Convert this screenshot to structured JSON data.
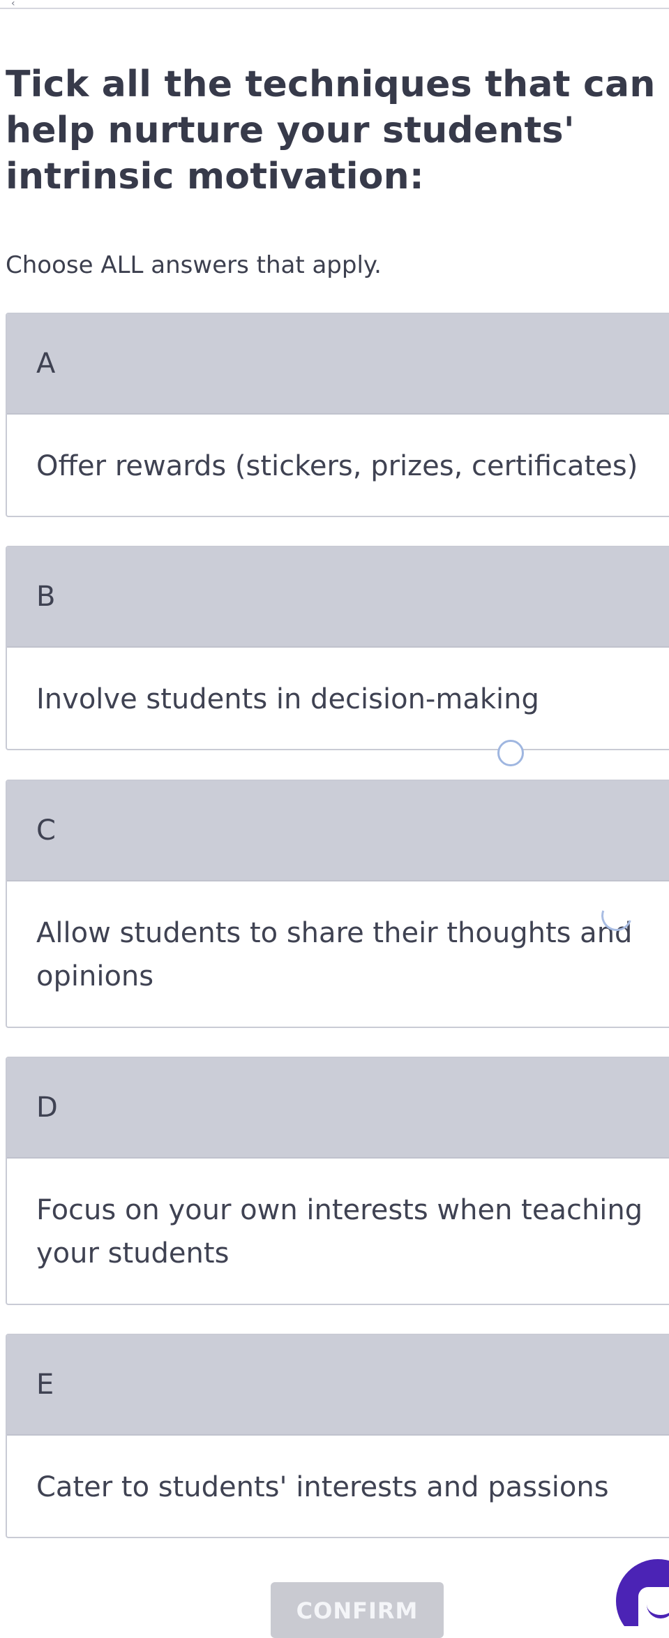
{
  "header": {
    "back_glyph": "‹"
  },
  "quiz": {
    "question": "Tick all the techniques that can help nurture your students' intrinsic motivation:",
    "instruction": "Choose ALL answers that apply.",
    "options": [
      {
        "letter": "A",
        "text": "Offer rewards (stickers, prizes, certificates)",
        "selected": false
      },
      {
        "letter": "B",
        "text": "Involve students in decision-making",
        "selected": false
      },
      {
        "letter": "C",
        "text": "Allow students to share their thoughts and opinions",
        "selected": false
      },
      {
        "letter": "D",
        "text": "Focus on your own interests when teaching your students",
        "selected": false
      },
      {
        "letter": "E",
        "text": "Cater to students' interests and passions",
        "selected": false
      }
    ],
    "confirm_label": "CONFIRM"
  },
  "colors": {
    "option_header": "#cbcdd7",
    "option_border": "#c9cbd5",
    "text": "#3f4252",
    "confirm_disabled": "#c9cad1",
    "chat_accent": "#4b23b5",
    "ring": "#9fb6e0"
  },
  "icons": {
    "back": "chevron-left-icon",
    "chat": "chat-icon",
    "ring": "ring-icon"
  }
}
